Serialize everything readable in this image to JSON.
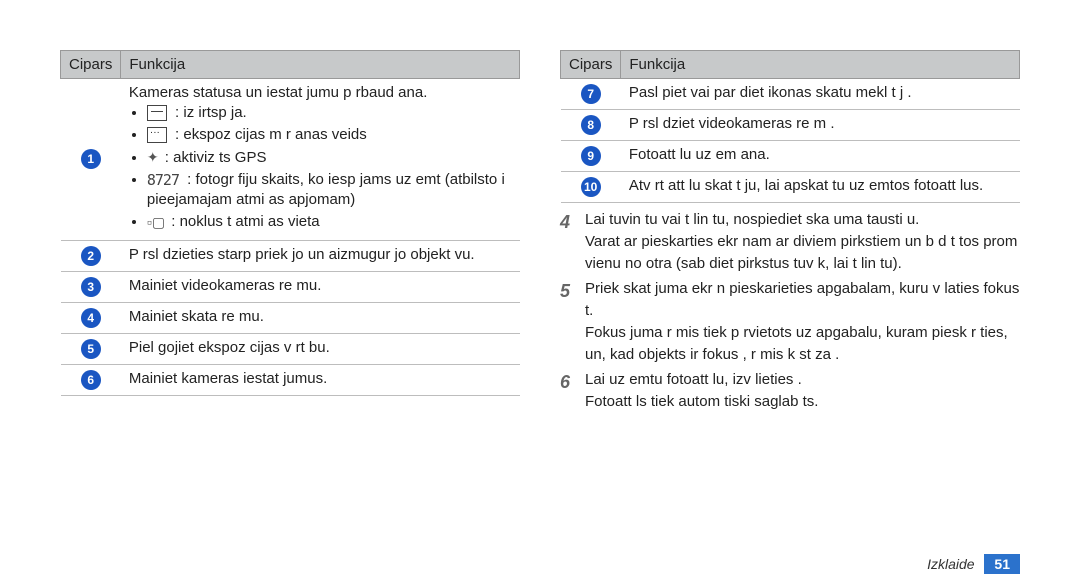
{
  "table_headers": {
    "col1": "Cipars",
    "col2": "Funkcija"
  },
  "left_rows": [
    {
      "num": "1",
      "text": "Kameras statusa un iestat jumu p rbaud ana.",
      "bullets": [
        {
          "icon": "card-icon",
          "text": ": iz irtsp ja."
        },
        {
          "icon": "exposure-icon",
          "text": ": ekspoz cijas m r anas veids"
        },
        {
          "icon": "gps-icon",
          "text": ": aktiviz ts GPS"
        },
        {
          "icon": "counter-icon",
          "counter": "8727",
          "text": ": fotogr fiju skaits, ko iesp jams uz emt (atbilsto i pieejamajam atmi as apjomam)"
        },
        {
          "icon": "storage-icon",
          "text": ": noklus t  atmi as vieta"
        }
      ]
    },
    {
      "num": "2",
      "text": "P rsl dzieties starp priek jo un aizmugur jo objekt vu."
    },
    {
      "num": "3",
      "text": "Mainiet videokameras re mu."
    },
    {
      "num": "4",
      "text": "Mainiet skata re mu."
    },
    {
      "num": "5",
      "text": "Piel gojiet ekspoz cijas v rt bu."
    },
    {
      "num": "6",
      "text": "Mainiet kameras iestat jumus."
    }
  ],
  "right_rows": [
    {
      "num": "7",
      "text": "Pasl piet vai par diet ikonas skatu mekl t j ."
    },
    {
      "num": "8",
      "text": "P rsl dziet videokameras re m ."
    },
    {
      "num": "9",
      "text": "Fotoatt lu uz em ana."
    },
    {
      "num": "10",
      "text": "Atv rt att lu skat t ju, lai apskat tu uz emtos fotoatt lus."
    }
  ],
  "steps": [
    {
      "num": "4",
      "text": "Lai tuvin tu vai t lin tu, nospiediet ska uma tausti u.",
      "cont": "Varat ar  pieskarties ekr nam ar diviem pirkstiem un b d t tos prom vienu no otra (sab diet pirkstus tuv k, lai t lin tu)."
    },
    {
      "num": "5",
      "text": "Priek skat juma ekr n  pieskarieties apgabalam, kuru v laties fokus t.",
      "cont": "Fokus juma r mis tiek p rvietots uz apgabalu, kuram piesk r ties, un, kad objekts ir fokus , r mis k st za ."
    },
    {
      "num": "6",
      "text": "Lai uz emtu fotoatt lu, izv lieties        .",
      "cont": "Fotoatt ls tiek autom tiski saglab ts."
    }
  ],
  "footer": {
    "section": "Izklaide",
    "page": "51"
  }
}
